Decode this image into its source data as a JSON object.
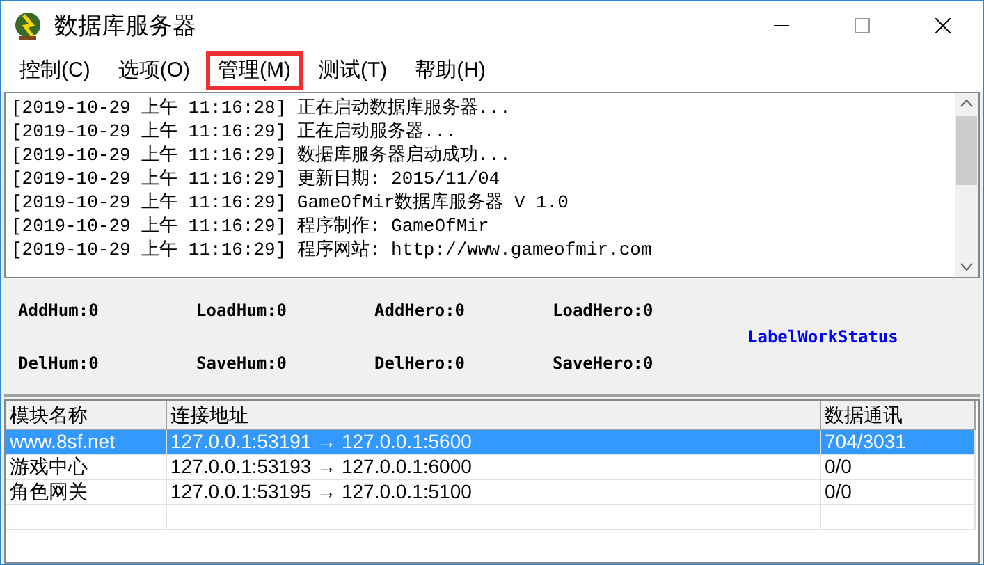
{
  "window": {
    "title": "数据库服务器"
  },
  "menu": [
    {
      "label": "控制(C)",
      "highlighted": false
    },
    {
      "label": "选项(O)",
      "highlighted": false
    },
    {
      "label": "管理(M)",
      "highlighted": true
    },
    {
      "label": "测试(T)",
      "highlighted": false
    },
    {
      "label": "帮助(H)",
      "highlighted": false
    }
  ],
  "log": [
    "[2019-10-29 上午 11:16:28] 正在启动数据库服务器...",
    "[2019-10-29 上午 11:16:29] 正在启动服务器...",
    "[2019-10-29 上午 11:16:29] 数据库服务器启动成功...",
    "[2019-10-29 上午 11:16:29] 更新日期: 2015/11/04",
    "[2019-10-29 上午 11:16:29] GameOfMir数据库服务器 V 1.0",
    "[2019-10-29 上午 11:16:29] 程序制作: GameOfMir",
    "[2019-10-29 上午 11:16:29] 程序网站: http://www.gameofmir.com"
  ],
  "stats": [
    [
      "AddHum:0",
      "LoadHum:0",
      "AddHero:0",
      "LoadHero:0"
    ],
    [
      "DelHum:0",
      "SaveHum:0",
      "DelHero:0",
      "SaveHero:0"
    ]
  ],
  "work_status": "LabelWorkStatus",
  "table": {
    "columns": [
      "模块名称",
      "连接地址",
      "数据通讯"
    ],
    "rows": [
      {
        "cells": [
          "www.8sf.net",
          "127.0.0.1:53191 → 127.0.0.1:5600",
          "704/3031"
        ],
        "selected": true
      },
      {
        "cells": [
          "游戏中心",
          "127.0.0.1:53193 → 127.0.0.1:6000",
          "0/0"
        ],
        "selected": false
      },
      {
        "cells": [
          "角色网关",
          "127.0.0.1:53195 → 127.0.0.1:5100",
          "0/0"
        ],
        "selected": false
      }
    ]
  }
}
